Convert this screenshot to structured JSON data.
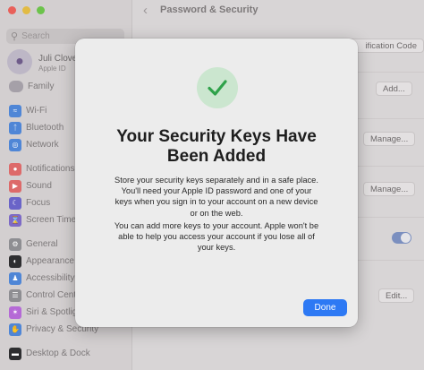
{
  "window": {
    "title": "Password & Security",
    "traffic_colors": [
      "#e9605a",
      "#e2bb44",
      "#6cc34b"
    ]
  },
  "sidebar": {
    "search_placeholder": "Search",
    "user": {
      "name": "Juli Clover",
      "subtitle": "Apple ID"
    },
    "family_label": "Family",
    "items": [
      {
        "label": "Wi-Fi",
        "icon": "wifi-icon",
        "color": "#4f86d6"
      },
      {
        "label": "Bluetooth",
        "icon": "bluetooth-icon",
        "color": "#4f86d6"
      },
      {
        "label": "Network",
        "icon": "globe-icon",
        "color": "#4f86d6"
      },
      {
        "label": "Notifications",
        "icon": "bell-icon",
        "color": "#dd6a6a"
      },
      {
        "label": "Sound",
        "icon": "speaker-icon",
        "color": "#dd6a6a"
      },
      {
        "label": "Focus",
        "icon": "moon-icon",
        "color": "#6a64c8"
      },
      {
        "label": "Screen Time",
        "icon": "hourglass-icon",
        "color": "#7d6ac6"
      },
      {
        "label": "General",
        "icon": "gear-icon",
        "color": "#8e8e92"
      },
      {
        "label": "Appearance",
        "icon": "appearance-icon",
        "color": "#2e2e30"
      },
      {
        "label": "Accessibility",
        "icon": "accessibility-icon",
        "color": "#4f86d6"
      },
      {
        "label": "Control Centre",
        "icon": "control-centre-icon",
        "color": "#8e8e92"
      },
      {
        "label": "Siri & Spotlight",
        "icon": "siri-icon",
        "color": "#b56ad6"
      },
      {
        "label": "Privacy & Security",
        "icon": "hand-icon",
        "color": "#4f86d6"
      },
      {
        "label": "Desktop & Dock",
        "icon": "dock-icon",
        "color": "#2e2e30"
      }
    ]
  },
  "main": {
    "buttons": {
      "verification_code": "ification Code",
      "add": "Add...",
      "manage_1": "Manage...",
      "manage_2": "Manage...",
      "edit": "Edit..."
    },
    "toggle_on": true
  },
  "modal": {
    "icon": "checkmark-icon",
    "accent_color": "#2fa24a",
    "title": "Your Security Keys Have\nBeen Added",
    "paragraph_1": "Store your security keys separately and in a safe place. You'll need your Apple ID password and one of your keys when you sign in to your account on a new device or on the web.",
    "paragraph_2": "You can add more keys to your account. Apple won't be able to help you access your account if you lose all of your keys.",
    "done_label": "Done"
  }
}
